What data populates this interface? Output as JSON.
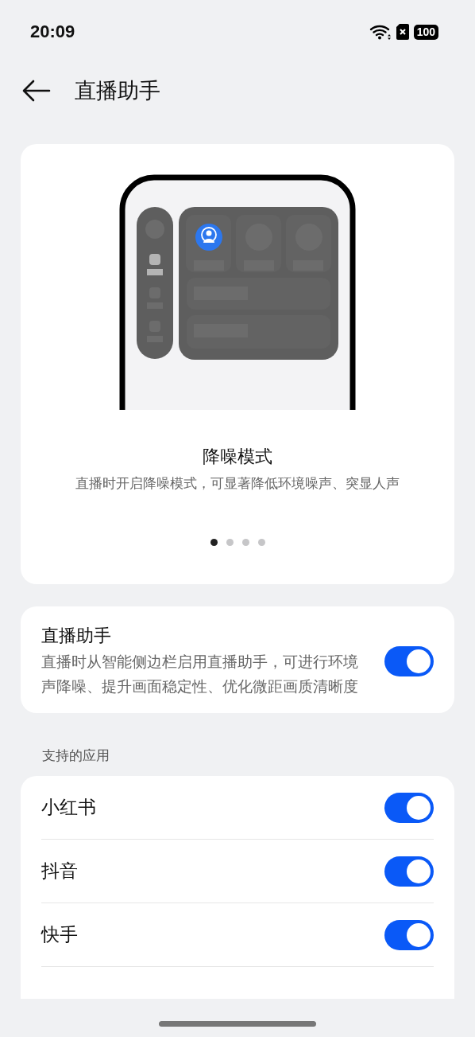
{
  "status_bar": {
    "time": "20:09",
    "battery": "100"
  },
  "header": {
    "title": "直播助手"
  },
  "carousel": {
    "title": "降噪模式",
    "description": "直播时开启降噪模式，可显著降低环境噪声、突显人声",
    "pages": [
      {
        "selected": true
      },
      {
        "selected": false
      },
      {
        "selected": false
      },
      {
        "selected": false
      }
    ]
  },
  "main_setting": {
    "title": "直播助手",
    "description": "直播时从智能侧边栏启用直播助手，可进行环境声降噪、提升画面稳定性、优化微距画质清晰度",
    "on": true
  },
  "section_label": "支持的应用",
  "apps": [
    {
      "name": "小红书",
      "on": true
    },
    {
      "name": "抖音",
      "on": true
    },
    {
      "name": "快手",
      "on": true
    }
  ]
}
